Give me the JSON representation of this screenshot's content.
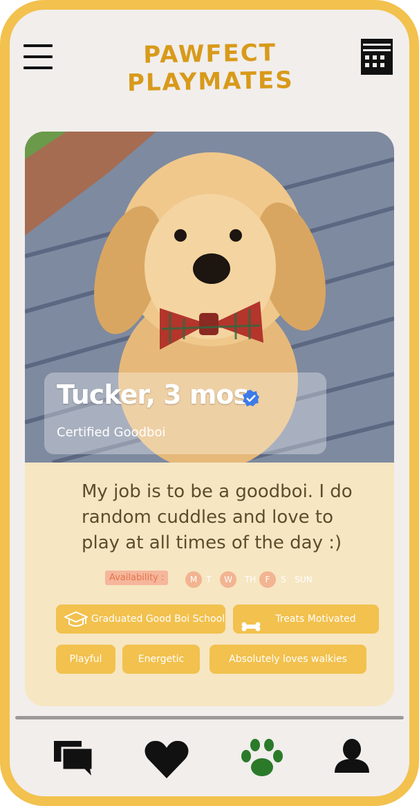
{
  "header": {
    "title": "PAWFECT PLAYMATES",
    "menu_icon": "hamburger-menu-icon",
    "calendar_icon": "calendar-icon"
  },
  "profile": {
    "name": "Tucker, 3 mos.",
    "subtitle": "Certified Goodboi",
    "verified_icon": "verified-badge-icon",
    "verified_color": "#3d7be8",
    "bio": "My job is to be a goodboi. I do random cuddles and love to play at all times of the day :)"
  },
  "availability": {
    "label": "Availability :",
    "days": [
      {
        "label": "M",
        "available": true
      },
      {
        "label": "T",
        "available": false
      },
      {
        "label": "W",
        "available": true
      },
      {
        "label": "TH",
        "available": false
      },
      {
        "label": "F",
        "available": true
      },
      {
        "label": "S",
        "available": false
      },
      {
        "label": "SUN",
        "available": false
      }
    ]
  },
  "tags": [
    {
      "label": "Graduated Good Boi School",
      "icon": "graduation-cap-icon"
    },
    {
      "label": "Treats Motivated",
      "icon": "bone-icon"
    },
    {
      "label": "Playful"
    },
    {
      "label": "Energetic"
    },
    {
      "label": "Absolutely loves walkies"
    }
  ],
  "nav": [
    {
      "name": "chats",
      "icon": "chat-bubbles-icon",
      "active": false
    },
    {
      "name": "likes",
      "icon": "heart-icon",
      "active": false
    },
    {
      "name": "playmates",
      "icon": "paw-icon",
      "active": true
    },
    {
      "name": "profile",
      "icon": "user-icon",
      "active": false
    }
  ],
  "colors": {
    "accent": "#f2c14e",
    "title": "#d89a1a",
    "card": "#f6e6c2",
    "active_nav": "#2a7a2a"
  }
}
